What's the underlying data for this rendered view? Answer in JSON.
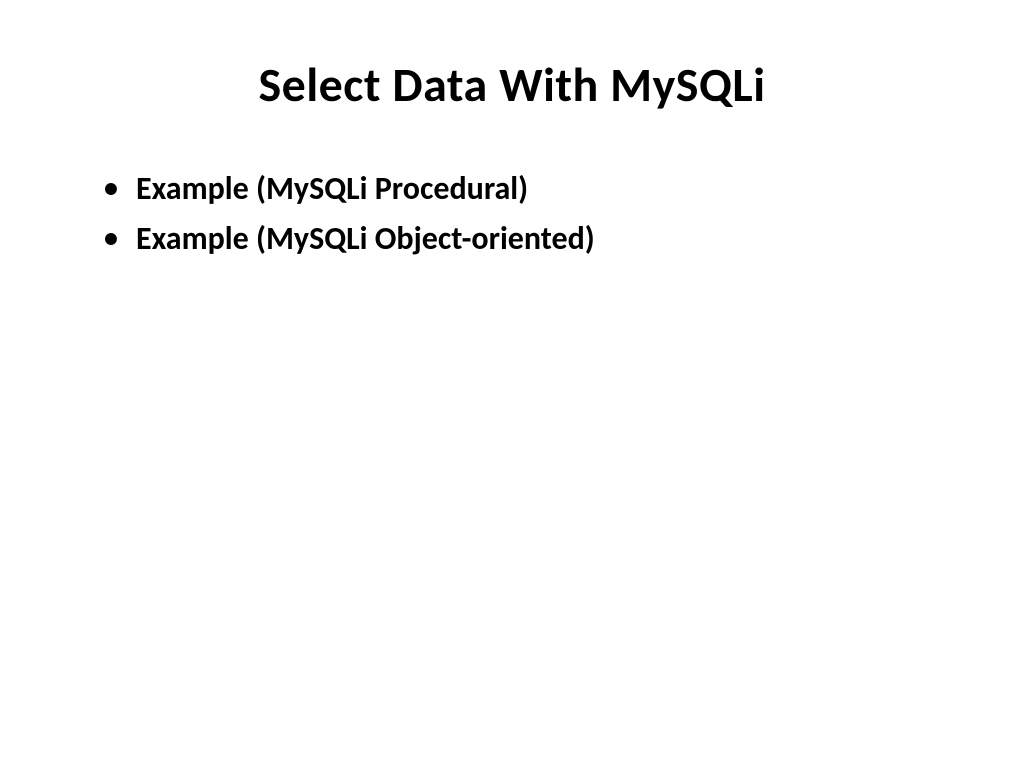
{
  "slide": {
    "title": "Select Data With MySQLi",
    "bullets": [
      "Example (MySQLi Procedural)",
      "Example (MySQLi Object-oriented)"
    ]
  }
}
